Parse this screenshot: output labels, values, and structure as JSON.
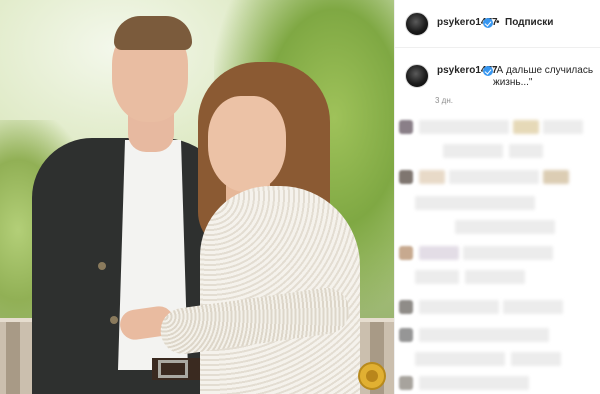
{
  "post": {
    "username": "psykero1477",
    "follow_label": "Подписки",
    "separator": "•",
    "caption_user": "psykero1477",
    "caption_text": "\"А дальше случилась жизнь...\"",
    "time_ago": "3 дн.",
    "verified": true
  },
  "colors": {
    "verified_badge": "#3897f0",
    "text_primary": "#262626",
    "text_secondary": "#8e8e8e",
    "border": "#efefef"
  },
  "comments": {
    "blurred": true
  }
}
